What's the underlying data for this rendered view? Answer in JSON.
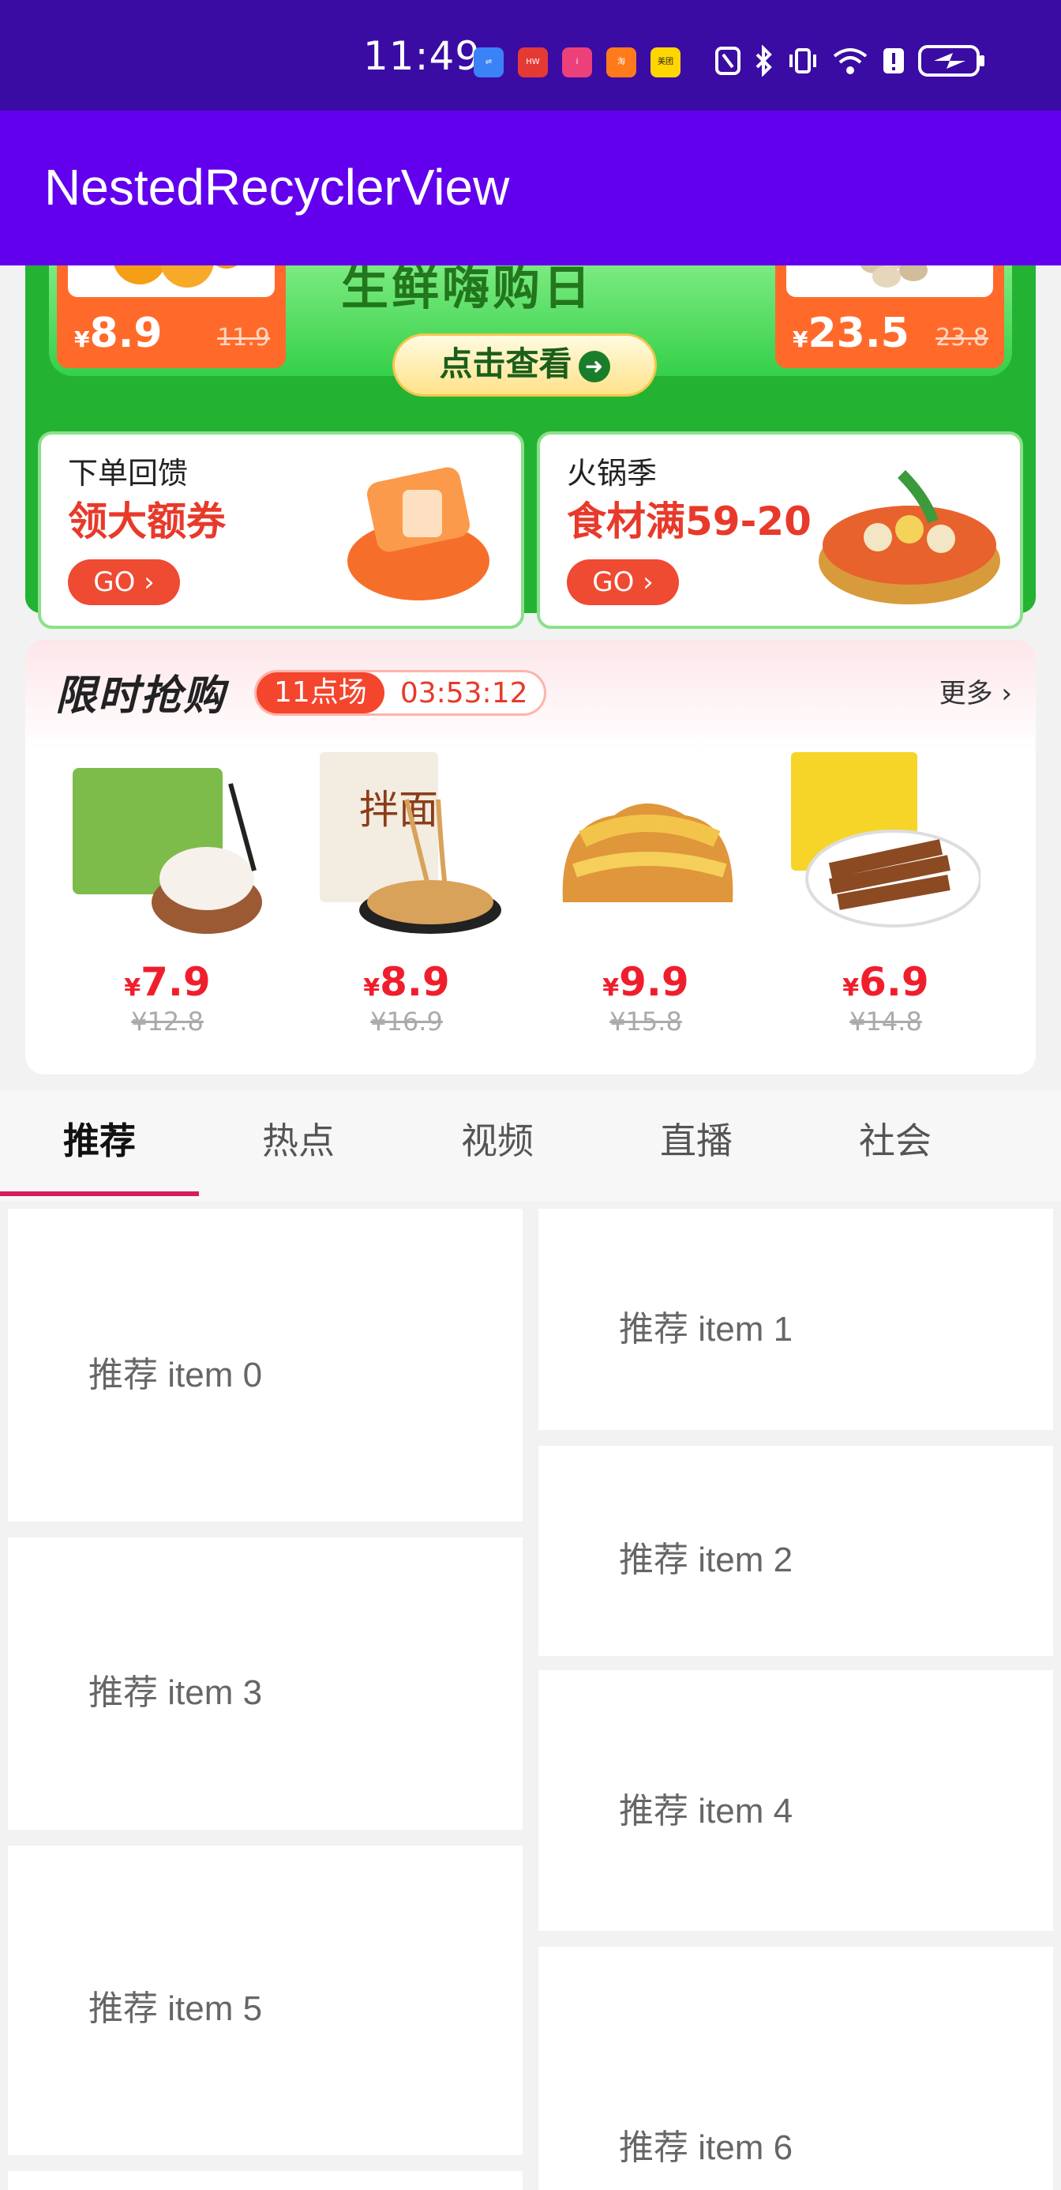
{
  "status_bar": {
    "time": "11:49"
  },
  "toolbar": {
    "title": "NestedRecyclerView"
  },
  "promo": {
    "headline": "生鲜嗨购日",
    "check_button": "点击查看",
    "products": [
      {
        "price": "8.9",
        "currency": "¥",
        "old_price": "11.9"
      },
      {
        "price": "23.5",
        "currency": "¥",
        "old_price": "23.8"
      }
    ],
    "cards": [
      {
        "label1": "下单回馈",
        "label2": "领大额券",
        "go": "GO"
      },
      {
        "label1": "火锅季",
        "label2": "食材满59-20",
        "go": "GO"
      }
    ]
  },
  "flash_sale": {
    "title": "限时抢购",
    "session": "11点场",
    "countdown": "03:53:12",
    "more": "更多",
    "items": [
      {
        "price": "7.9",
        "currency": "¥",
        "old_price": "¥12.8",
        "image": "dumplings"
      },
      {
        "price": "8.9",
        "currency": "¥",
        "old_price": "¥16.9",
        "image": "noodles"
      },
      {
        "price": "9.9",
        "currency": "¥",
        "old_price": "¥15.8",
        "image": "bread"
      },
      {
        "price": "6.9",
        "currency": "¥",
        "old_price": "¥14.8",
        "image": "duck-wings"
      }
    ]
  },
  "tabs": [
    "推荐",
    "热点",
    "视频",
    "直播",
    "社会"
  ],
  "feed_items": [
    "推荐 item 0",
    "推荐 item 1",
    "推荐 item 2",
    "推荐 item 3",
    "推荐 item 4",
    "推荐 item 5",
    "推荐 item 6"
  ],
  "colors": {
    "status_bar": "#3a0ca3",
    "toolbar": "#6200ee",
    "tab_indicator": "#d81b60",
    "price_red": "#f01e2c"
  }
}
